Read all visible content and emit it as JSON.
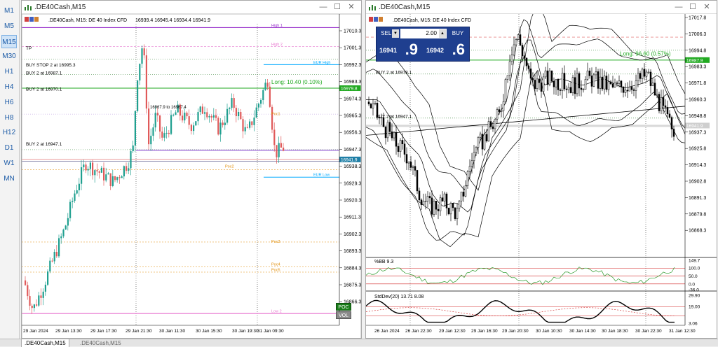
{
  "timeframes": [
    "M1",
    "M5",
    "M15",
    "M30",
    "H1",
    "H4",
    "H6",
    "H8",
    "H12",
    "D1",
    "W1",
    "MN"
  ],
  "active_timeframe": "M15",
  "left_window": {
    "title": ".DE40Cash,M15",
    "info": ".DE40Cash, M15: DE 40 Index CFD",
    "ohlc": "16939.4 16945.4 16934.4 16941.9",
    "price_ticks": [
      "17010.3",
      "17001.3",
      "16992.3",
      "16983.3",
      "16974.3",
      "16965.3",
      "16956.3",
      "16947.3",
      "16938.3",
      "16929.3",
      "16920.3",
      "16911.3",
      "16902.3",
      "16893.3",
      "16884.3",
      "16875.3",
      "16866.3"
    ],
    "time_ticks": [
      "29 Jan 2024",
      "29 Jan 13:30",
      "29 Jan 17:30",
      "29 Jan 21:30",
      "30 Jan 11:30",
      "30 Jan 15:30",
      "30 Jan 19:30",
      "31 Jan 09:30"
    ],
    "order_labels": [
      "TP",
      "BUY STOP 2 at 16995.3",
      "BUY 2 at 16987.1",
      "BUY 2 at 16970.1",
      "BUY 2 at 16947.1"
    ],
    "position_label": "Long: 10.40  (0.10%)",
    "current_price": "16941.9",
    "green_price": "16979.8",
    "level_labels": [
      "High 1",
      "High 2",
      "EUR High",
      "Poc1",
      "Poc2",
      "Poc3",
      "Poc4",
      "Poc5",
      "Low 2",
      "EUR Low"
    ],
    "box_text": "16967.9 to 16967.4",
    "poc_button": "POC",
    "vol_button": "VOL"
  },
  "right_window": {
    "title": ".DE40Cash,M15",
    "info": ".DE40Cash, M15: DE 40 Index CFD",
    "sell_label": "SELL",
    "buy_label": "BUY",
    "lot": "2.00",
    "bid_small": "16941",
    "bid_big": ".9",
    "ask_small": "16942",
    "ask_big": ".6",
    "price_ticks": [
      "17017.8",
      "17006.3",
      "16994.8",
      "16983.3",
      "16971.8",
      "16960.3",
      "16948.8",
      "16937.3",
      "16925.8",
      "16914.3",
      "16902.8",
      "16891.3",
      "16879.8",
      "16868.3"
    ],
    "time_ticks": [
      "26 Jan 2024",
      "26 Jan 22:30",
      "29 Jan 12:30",
      "29 Jan 16:30",
      "29 Jan 20:30",
      "30 Jan 10:30",
      "30 Jan 14:30",
      "30 Jan 18:30",
      "30 Jan 22:30",
      "31 Jan 12:30"
    ],
    "order_labels": [
      "BUY 2 at 16987.1",
      "BUY 2 at 16978.1",
      "BUY 2 at 16947.1"
    ],
    "position_label": "Long: 96.60  (0.57%)",
    "green_price": "16987.9",
    "current_price": "16941.9",
    "bb_label": "%BB 9.3",
    "bb_ticks": [
      "149.7",
      "100.0",
      "50.0",
      "0.0",
      "-36.0"
    ],
    "std_label": "StdDev(20) 13.71 8.08",
    "std_ticks": [
      "29.90",
      "19.00",
      "3.06"
    ]
  },
  "tabs": [
    ".DE40Cash,M15",
    ".DE40Cash,M15"
  ],
  "colors": {
    "bull": "#1f9f8f",
    "bear": "#e05a5a",
    "green_line": "#22aa22",
    "purple": "#9933cc",
    "cyan": "#00aaff",
    "navy": "#1f3f8f",
    "orange": "#e08a00"
  }
}
